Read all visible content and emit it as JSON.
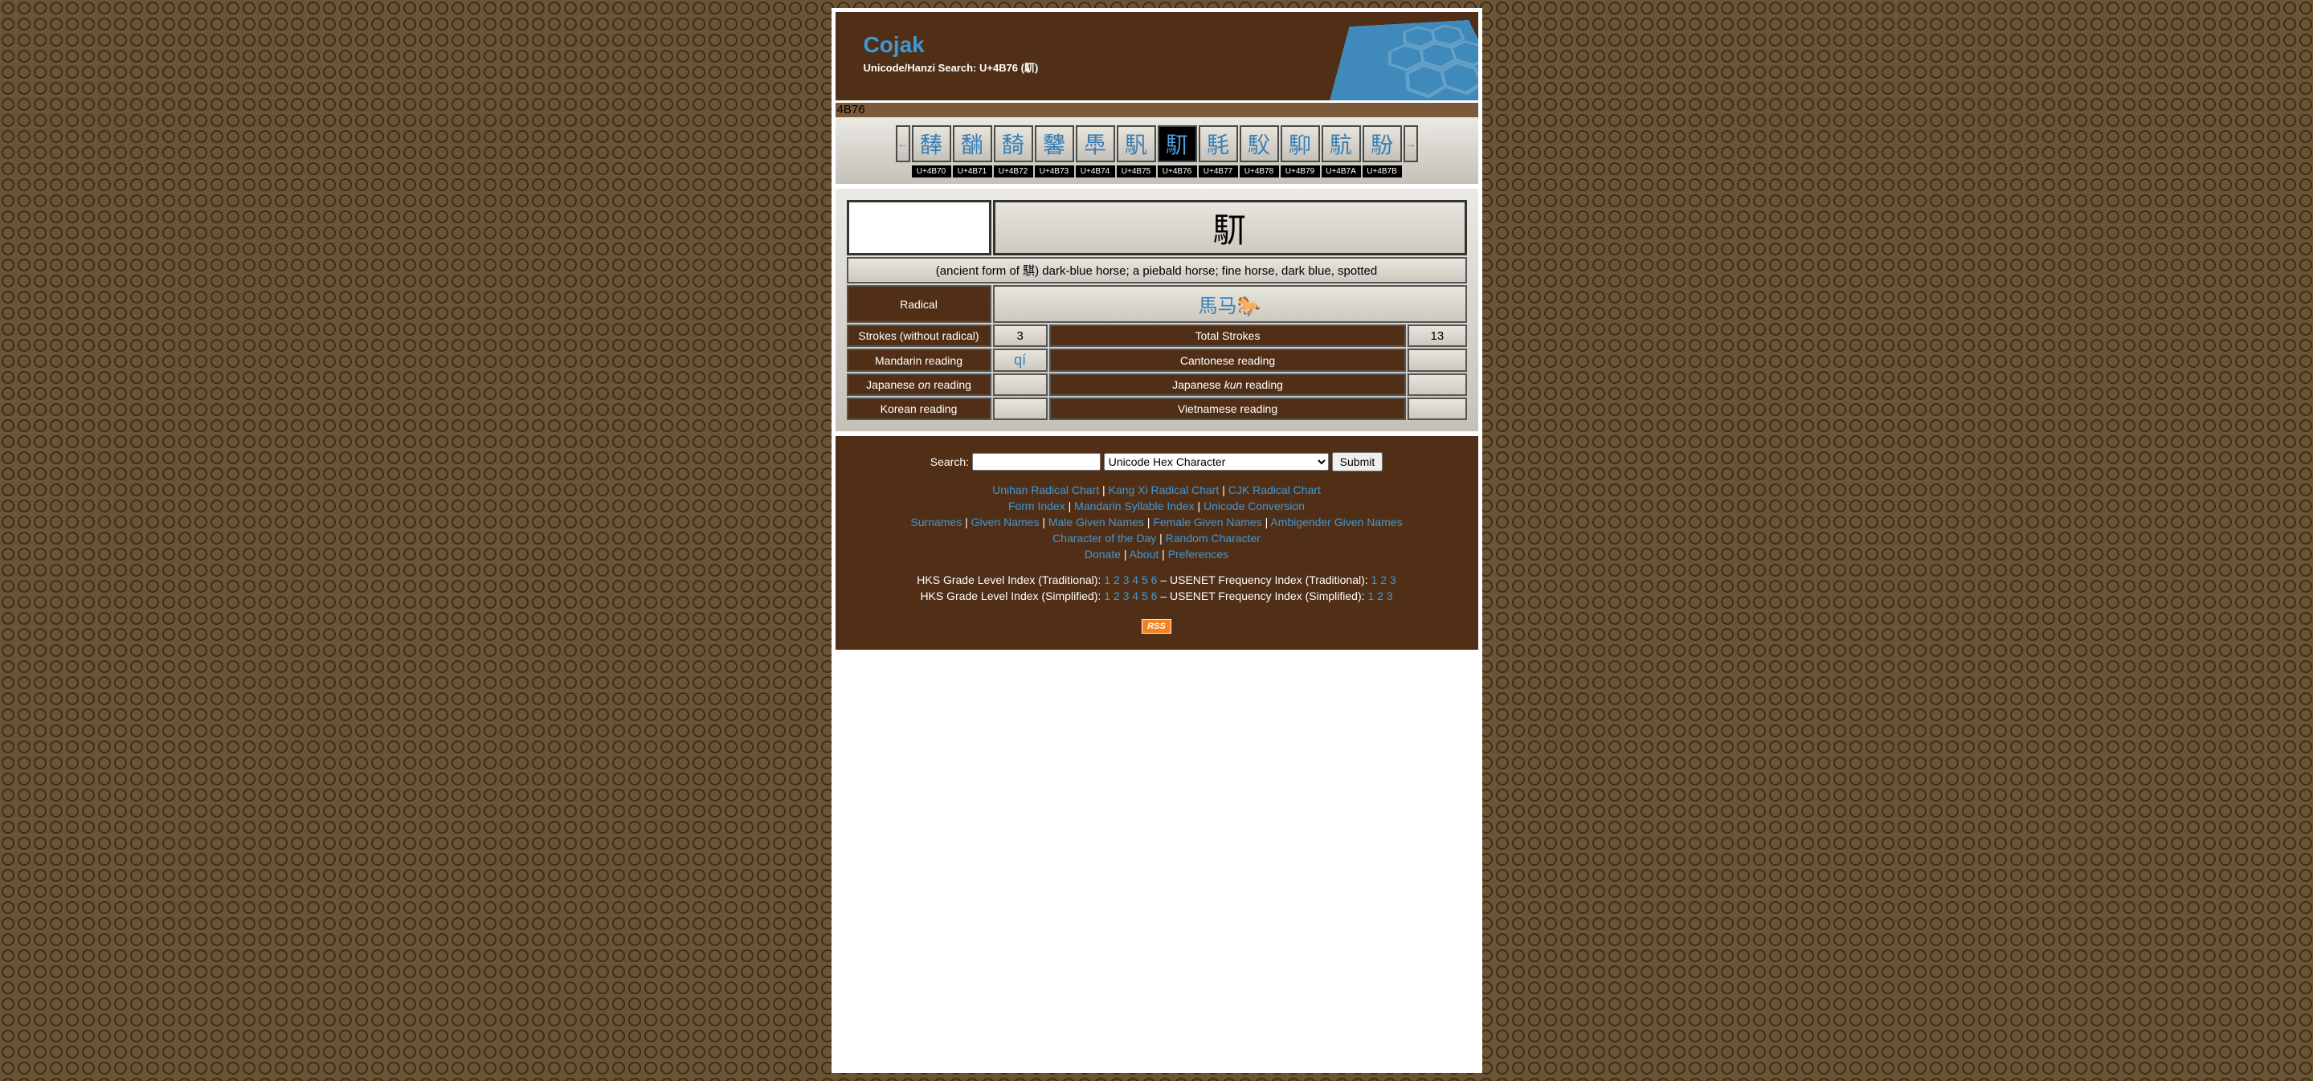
{
  "header": {
    "title": "Cojak",
    "subtitle": "Unicode/Hanzi Search: U+4B76 (䭶)",
    "codeline": "4B76"
  },
  "nav": {
    "prev_arrow": "←",
    "next_arrow": "→",
    "chars": [
      "䭰",
      "䭱",
      "䭲",
      "䭳",
      "䭴",
      "䭵",
      "䭶",
      "䭷",
      "䭸",
      "䭹",
      "䭺",
      "䭻"
    ],
    "codes": [
      "U+4B70",
      "U+4B71",
      "U+4B72",
      "U+4B73",
      "U+4B74",
      "U+4B75",
      "U+4B76",
      "U+4B77",
      "U+4B78",
      "U+4B79",
      "U+4B7A",
      "U+4B7B"
    ],
    "active_index": 6
  },
  "detail": {
    "big_char": "䭶",
    "definition": "(ancient form of 騏) dark-blue horse; a piebald horse; fine horse, dark blue, spotted",
    "radical_label": "Radical",
    "radical_value": "馬马🐎",
    "strokes_wo_label": "Strokes (without radical)",
    "strokes_wo_value": "3",
    "total_strokes_label": "Total Strokes",
    "total_strokes_value": "13",
    "mandarin_label": "Mandarin reading",
    "mandarin_value": "qí",
    "cantonese_label": "Cantonese reading",
    "cantonese_value": "",
    "jp_on_label_pre": "Japanese ",
    "jp_on_label_em": "on",
    "jp_on_label_post": " reading",
    "jp_on_value": "",
    "jp_kun_label_pre": "Japanese ",
    "jp_kun_label_em": "kun",
    "jp_kun_label_post": " reading",
    "jp_kun_value": "",
    "korean_label": "Korean reading",
    "korean_value": "",
    "vietnamese_label": "Vietnamese reading",
    "vietnamese_value": ""
  },
  "footer": {
    "search_label": "Search:",
    "search_value": "",
    "select_value": "Unicode Hex Character",
    "submit_label": "Submit",
    "row1": [
      "Unihan Radical Chart",
      "Kang Xi Radical Chart",
      "CJK Radical Chart"
    ],
    "row2": [
      "Form Index",
      "Mandarin Syllable Index",
      "Unicode Conversion"
    ],
    "row3": [
      "Surnames",
      "Given Names",
      "Male Given Names",
      "Female Given Names",
      "Ambigender Given Names"
    ],
    "row4": [
      "Character of the Day",
      "Random Character"
    ],
    "row5": [
      "Donate",
      "About",
      "Preferences"
    ],
    "hks_trad_label": "HKS Grade Level Index (Traditional): ",
    "hks_trad_nums": [
      "1",
      "2",
      "3",
      "4",
      "5",
      "6"
    ],
    "usenet_trad_label": " – USENET Frequency Index (Traditional): ",
    "usenet_trad_nums": [
      "1",
      "2",
      "3"
    ],
    "hks_simp_label": "HKS Grade Level Index (Simplified): ",
    "hks_simp_nums": [
      "1",
      "2",
      "3",
      "4",
      "5",
      "6"
    ],
    "usenet_simp_label": " – USENET Frequency Index (Simplified): ",
    "usenet_simp_nums": [
      "1",
      "2",
      "3"
    ],
    "rss": "RSS"
  }
}
